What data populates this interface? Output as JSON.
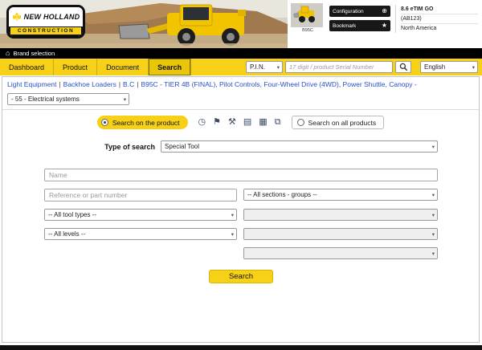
{
  "colors": {
    "yellow": "#f7d117",
    "black": "#111111",
    "link_blue": "#2b50c8"
  },
  "header": {
    "logo_title": "NEW HOLLAND",
    "logo_subtitle": "CONSTRUCTION",
    "thumbnail_caption": "B95C",
    "configuration_button": "Configuration",
    "bookmark_button": "Bookmark",
    "app_version": "8.6 eTIM GO",
    "app_code": "(AB123)",
    "app_region": "North America"
  },
  "brand_bar": {
    "label": "Brand selection"
  },
  "nav": {
    "tabs": [
      "Dashboard",
      "Product",
      "Document",
      "Search"
    ],
    "active_tab": "Search",
    "pin_select": "P.I.N.",
    "serial_placeholder": "17 digit / product Serial Number",
    "language_select": "English"
  },
  "breadcrumb": {
    "separator": "|",
    "items": [
      "Light Equipment",
      "Backhoe Loaders",
      "B.C",
      "B95C - TIER 4B (FINAL), Pilot Controls, Four-Wheel Drive (4WD), Power Shuttle, Canopy -"
    ]
  },
  "filters": {
    "section_select": "- 55 - Electrical systems"
  },
  "scope": {
    "on_product_label": "Search on the product",
    "on_all_label": "Search on all products"
  },
  "form": {
    "type_label": "Type of search",
    "type_value": "Special Tool",
    "name_placeholder": "Name",
    "reference_placeholder": "Reference or part number",
    "sections_select": "-- All sections - groups --",
    "tool_types_select": "-- All tool types --",
    "levels_select": "-- All levels --",
    "empty_select": "",
    "search_button": "Search"
  },
  "icons": {
    "home": "⌂",
    "plus_circle": "⊕",
    "star": "★",
    "chevron": "▾",
    "history": "◷",
    "flag": "⚑",
    "tools": "⚒",
    "document": "▤",
    "table": "▦",
    "copy": "⧉"
  }
}
